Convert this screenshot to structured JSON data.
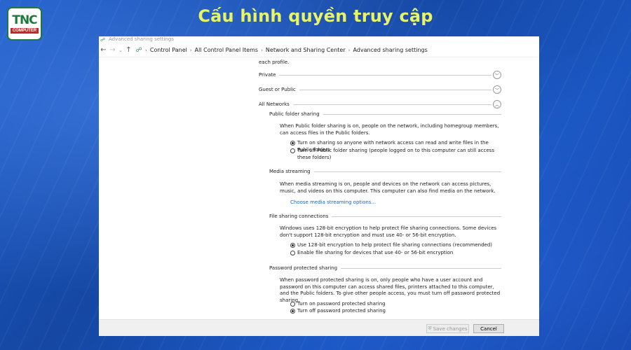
{
  "banner": {
    "logo_mark": "TNC",
    "logo_sub": "COMPUTER",
    "headline": "Cấu hình quyền truy cập"
  },
  "window": {
    "title": "Advanced sharing settings",
    "breadcrumbs": [
      "Control Panel",
      "All Control Panel Items",
      "Network and Sharing Center",
      "Advanced sharing settings"
    ]
  },
  "content": {
    "top_cut_text": "each profile.",
    "profiles": {
      "private": "Private",
      "guest": "Guest or Public",
      "all": "All Networks"
    },
    "public_folder": {
      "title": "Public folder sharing",
      "description": "When Public folder sharing is on, people on the network, including homegroup members, can access files in the Public folders.",
      "option_on": "Turn on sharing so anyone with network access can read and write files in the Public folders",
      "option_off": "Turn off Public folder sharing (people logged on to this computer can still access these folders)",
      "selected": "on"
    },
    "media_streaming": {
      "title": "Media streaming",
      "description": "When media streaming is on, people and devices on the network can access pictures, music, and videos on this computer. This computer can also find media on the network.",
      "link": "Choose media streaming options..."
    },
    "file_sharing": {
      "title": "File sharing connections",
      "description": "Windows uses 128-bit encryption to help protect file sharing connections. Some devices don't support 128-bit encryption and must use 40- or 56-bit encryption.",
      "option_128": "Use 128-bit encryption to help protect file sharing connections (recommended)",
      "option_40": "Enable file sharing for devices that use 40- or 56-bit encryption",
      "selected": "128"
    },
    "password": {
      "title": "Password protected sharing",
      "description": "When password protected sharing is on, only people who have a user account and password on this computer can access shared files, printers attached to this computer, and the Public folders. To give other people access, you must turn off password protected sharing.",
      "option_on": "Turn on password protected sharing",
      "option_off": "Turn off password protected sharing",
      "selected": "off"
    }
  },
  "footer": {
    "save_label": "Save changes",
    "cancel_label": "Cancel"
  }
}
